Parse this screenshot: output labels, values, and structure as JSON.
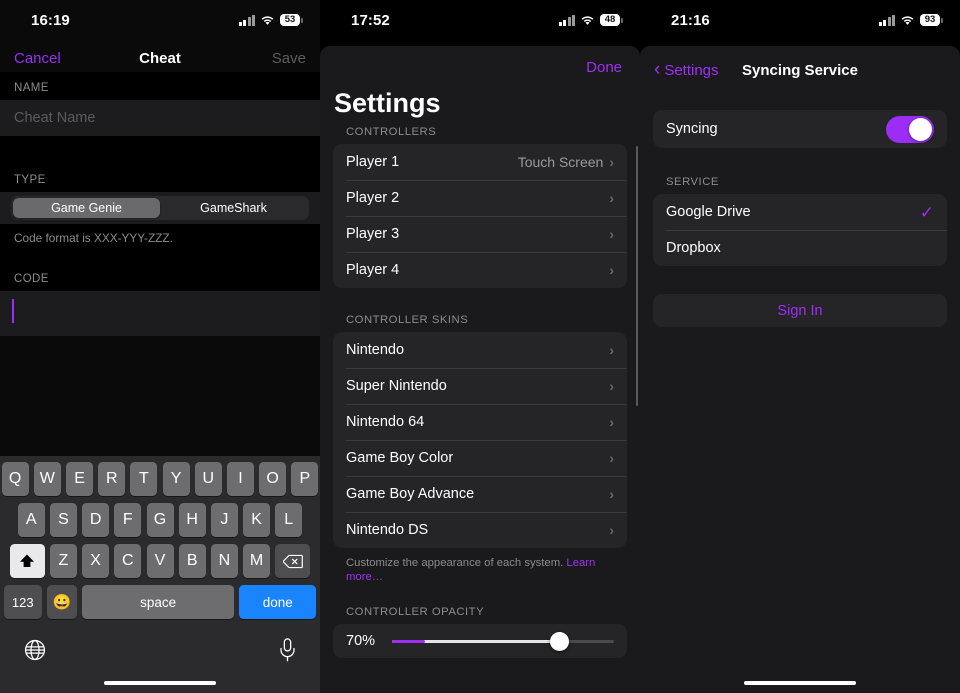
{
  "panel1": {
    "status": {
      "time": "16:19",
      "battery": "53",
      "signal_icon": "cellular-bars-icon",
      "wifi_icon": "wifi-icon"
    },
    "nav": {
      "cancel": "Cancel",
      "title": "Cheat",
      "save": "Save"
    },
    "sections": {
      "name_header": "NAME",
      "name_placeholder": "Cheat Name",
      "type_header": "TYPE",
      "type_options": [
        "Game Genie",
        "GameShark"
      ],
      "type_selected": "Game Genie",
      "type_hint": "Code format is XXX-YYY-ZZZ.",
      "code_header": "CODE",
      "code_value": ""
    },
    "keyboard": {
      "row1": [
        "Q",
        "W",
        "E",
        "R",
        "T",
        "Y",
        "U",
        "I",
        "O",
        "P"
      ],
      "row2": [
        "A",
        "S",
        "D",
        "F",
        "G",
        "H",
        "J",
        "K",
        "L"
      ],
      "row3": [
        "Z",
        "X",
        "C",
        "V",
        "B",
        "N",
        "M"
      ],
      "shift_icon": "shift-up-arrow-icon",
      "delete_icon": "backspace-delete-icon",
      "numeric_key": "123",
      "emoji_key": "😀",
      "space_key": "space",
      "return_key": "done",
      "globe_icon": "globe-language-icon",
      "mic_icon": "microphone-dictation-icon"
    },
    "accent": "#9b2df5"
  },
  "panel2": {
    "status": {
      "time": "17:52",
      "battery": "48",
      "signal_icon": "cellular-bars-icon",
      "wifi_icon": "wifi-icon"
    },
    "done_label": "Done",
    "title": "Settings",
    "controllers": {
      "header": "CONTROLLERS",
      "rows": [
        {
          "label": "Player 1",
          "value": "Touch Screen"
        },
        {
          "label": "Player 2",
          "value": ""
        },
        {
          "label": "Player 3",
          "value": ""
        },
        {
          "label": "Player 4",
          "value": ""
        }
      ]
    },
    "skins": {
      "header": "CONTROLLER SKINS",
      "rows": [
        {
          "label": "Nintendo"
        },
        {
          "label": "Super Nintendo"
        },
        {
          "label": "Nintendo 64"
        },
        {
          "label": "Game Boy Color"
        },
        {
          "label": "Game Boy Advance"
        },
        {
          "label": "Nintendo DS"
        }
      ],
      "footnote": "Customize the appearance of each system. ",
      "footnote_link": "Learn more…"
    },
    "opacity": {
      "header": "CONTROLLER OPACITY",
      "value": "70%"
    },
    "accent": "#a02ef7"
  },
  "panel3": {
    "status": {
      "time": "21:16",
      "battery": "93",
      "signal_icon": "cellular-bars-icon",
      "wifi_icon": "wifi-icon"
    },
    "back_label": "Settings",
    "title": "Syncing Service",
    "syncing": {
      "label": "Syncing",
      "enabled": true
    },
    "service": {
      "header": "SERVICE",
      "rows": [
        {
          "label": "Google Drive",
          "selected": true
        },
        {
          "label": "Dropbox",
          "selected": false
        }
      ]
    },
    "sign_in": "Sign In",
    "accent": "#a02ef7"
  }
}
